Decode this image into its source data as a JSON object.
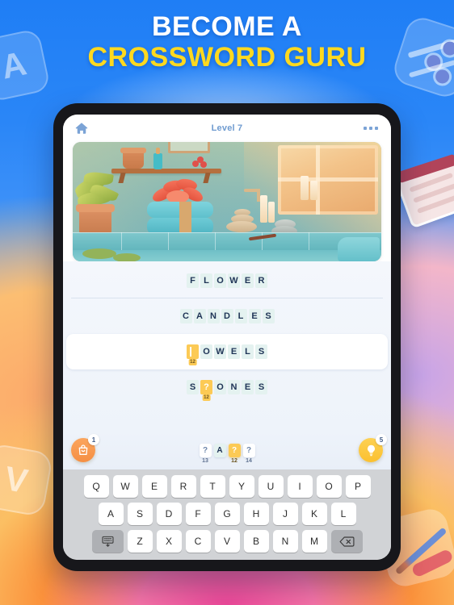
{
  "headline": {
    "line1": "BECOME A",
    "line2": "CROSSWORD GURU",
    "line1_color": "#ffffff",
    "line2_color": "#ffd91f"
  },
  "decor": {
    "tile_a_letter": "A",
    "tile_v_letter": "V",
    "plane_icon": "paper-plane-icon",
    "book_icon": "book-icon",
    "pencil_icon": "pencil-icon"
  },
  "appbar": {
    "home_icon": "home-icon",
    "title": "Level 7",
    "more_icon": "more-options-icon"
  },
  "picture": {
    "alt": "spa bathroom scene with flower, towels, candles and stones"
  },
  "wordlist": {
    "rows": [
      {
        "word": "FLOWER",
        "solved": true,
        "active": false,
        "tiles": [
          {
            "ch": "F"
          },
          {
            "ch": "L"
          },
          {
            "ch": "O"
          },
          {
            "ch": "W"
          },
          {
            "ch": "E"
          },
          {
            "ch": "R"
          }
        ]
      },
      {
        "word": "CANDLES",
        "solved": true,
        "active": false,
        "tiles": [
          {
            "ch": "C"
          },
          {
            "ch": "A"
          },
          {
            "ch": "N"
          },
          {
            "ch": "D"
          },
          {
            "ch": "L"
          },
          {
            "ch": "E"
          },
          {
            "ch": "S"
          }
        ]
      },
      {
        "word": "TOWELS",
        "solved": false,
        "active": true,
        "tiles": [
          {
            "ch": "",
            "highlight": true,
            "cursor": true,
            "num": "12"
          },
          {
            "ch": "O"
          },
          {
            "ch": "W"
          },
          {
            "ch": "E"
          },
          {
            "ch": "L"
          },
          {
            "ch": "S"
          }
        ]
      },
      {
        "word": "STONES",
        "solved": false,
        "active": false,
        "tiles": [
          {
            "ch": "S"
          },
          {
            "ch": "?",
            "highlight": true,
            "num": "12"
          },
          {
            "ch": "O"
          },
          {
            "ch": "N"
          },
          {
            "ch": "E"
          },
          {
            "ch": "S"
          }
        ]
      }
    ]
  },
  "powerbar": {
    "shop": {
      "icon": "bag-icon",
      "badge": "1"
    },
    "hint": {
      "icon": "lightbulb-icon",
      "badge": "5"
    },
    "tray": [
      {
        "ch": "?",
        "num": "13",
        "selected": false,
        "is_letter": false
      },
      {
        "ch": "A",
        "num": "",
        "selected": false,
        "is_letter": true
      },
      {
        "ch": "?",
        "num": "12",
        "selected": true,
        "is_letter": false
      },
      {
        "ch": "?",
        "num": "14",
        "selected": false,
        "is_letter": false
      }
    ]
  },
  "keyboard": {
    "row1": [
      "Q",
      "W",
      "E",
      "R",
      "T",
      "Y",
      "U",
      "I",
      "O",
      "P"
    ],
    "row2": [
      "A",
      "S",
      "D",
      "F",
      "G",
      "H",
      "J",
      "K",
      "L"
    ],
    "row3": [
      "Z",
      "X",
      "C",
      "V",
      "B",
      "N",
      "M"
    ],
    "hide_key_icon": "hide-keyboard-icon",
    "backspace_key_icon": "backspace-icon"
  }
}
